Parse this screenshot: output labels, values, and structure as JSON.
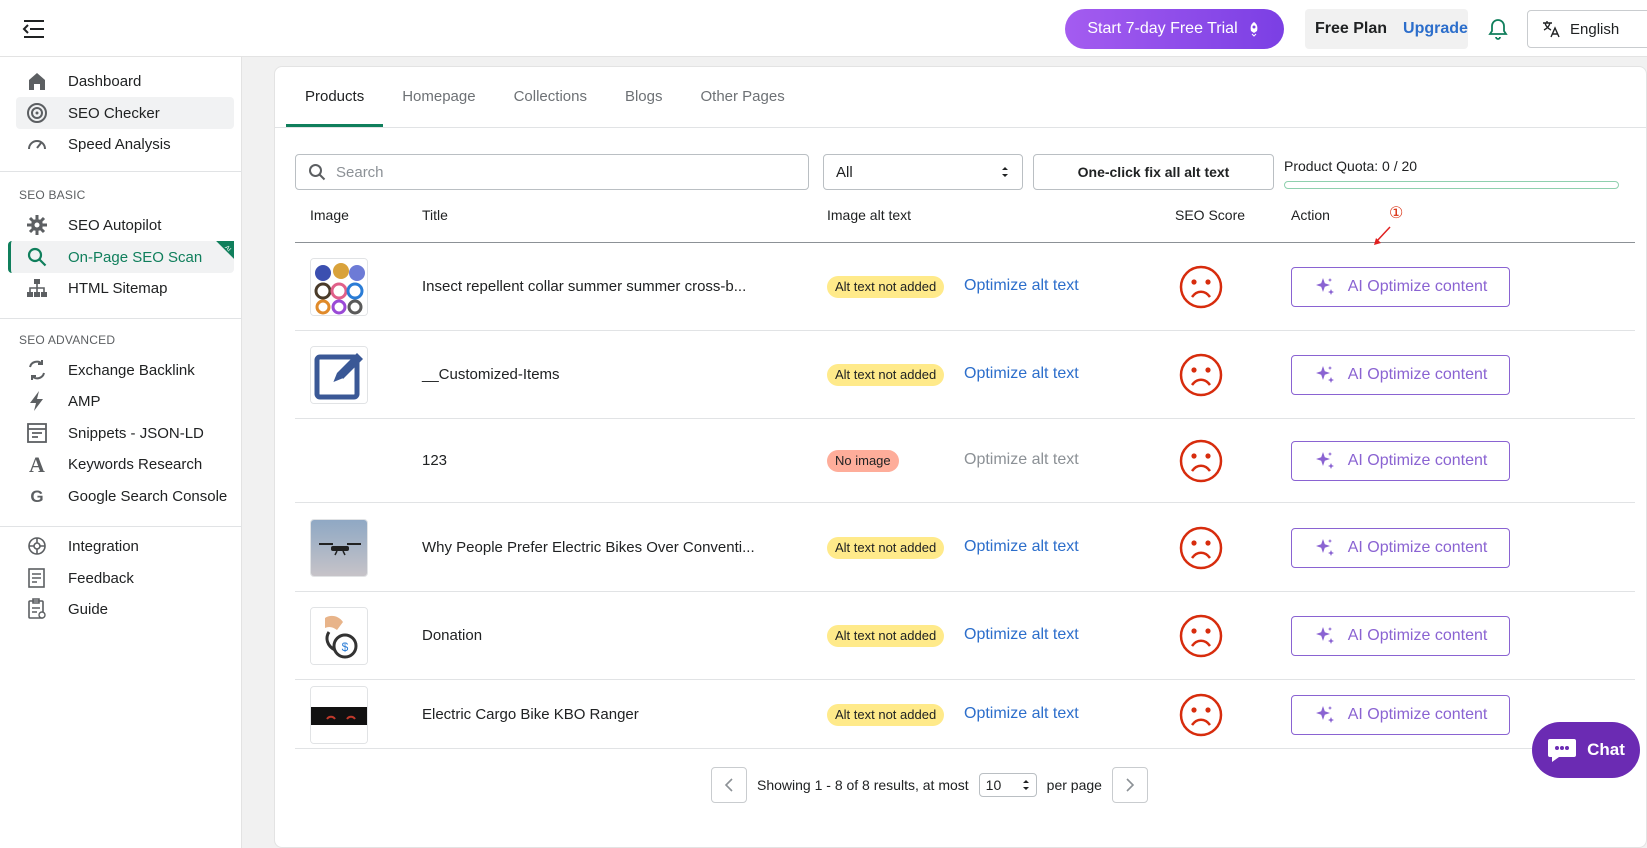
{
  "topbar": {
    "trial_label": "Start 7-day Free Trial",
    "plan_name": "Free Plan",
    "upgrade_label": "Upgrade",
    "language": "English"
  },
  "sidebar": {
    "main_items": [
      {
        "label": "Dashboard",
        "icon": "home-icon"
      },
      {
        "label": "SEO Checker",
        "icon": "target-icon"
      },
      {
        "label": "Speed Analysis",
        "icon": "speedometer-icon"
      }
    ],
    "basic_heading": "SEO BASIC",
    "basic_items": [
      {
        "label": "SEO Autopilot",
        "icon": "gear-icon"
      },
      {
        "label": "On-Page SEO Scan",
        "icon": "search-icon",
        "tag": "AI"
      },
      {
        "label": "HTML Sitemap",
        "icon": "sitemap-icon"
      }
    ],
    "advanced_heading": "SEO ADVANCED",
    "advanced_items": [
      {
        "label": "Exchange Backlink",
        "icon": "exchange-icon"
      },
      {
        "label": "AMP",
        "icon": "bolt-icon"
      },
      {
        "label": "Snippets - JSON-LD",
        "icon": "snippet-icon"
      },
      {
        "label": "Keywords Research",
        "icon": "letter-a-icon"
      },
      {
        "label": "Google Search Console",
        "icon": "google-icon"
      }
    ],
    "extra_items": [
      {
        "label": "Integration",
        "icon": "integration-icon"
      },
      {
        "label": "Feedback",
        "icon": "feedback-icon"
      },
      {
        "label": "Guide",
        "icon": "guide-icon"
      }
    ]
  },
  "tabs": [
    "Products",
    "Homepage",
    "Collections",
    "Blogs",
    "Other Pages"
  ],
  "filters": {
    "search_placeholder": "Search",
    "select_value": "All",
    "fix_all_label": "One-click fix all alt text",
    "quota_label": "Product Quota: 0 / 20",
    "quota_fraction": 0
  },
  "table": {
    "headers": {
      "image": "Image",
      "title": "Title",
      "alt": "Image alt text",
      "score": "SEO Score",
      "action": "Action"
    },
    "optimize_alt_label": "Optimize alt text",
    "ai_button_label": "AI Optimize content",
    "rows": [
      {
        "title": "Insect repellent collar summer summer cross-b...",
        "badge": "Alt text not added",
        "badge_type": "warn",
        "thumb": "collars-thumb",
        "alt_enabled": true
      },
      {
        "title": "__Customized-Items",
        "badge": "Alt text not added",
        "badge_type": "warn",
        "thumb": "edit-thumb",
        "alt_enabled": true
      },
      {
        "title": "123",
        "badge": "No image",
        "badge_type": "crit",
        "thumb": "none",
        "alt_enabled": false
      },
      {
        "title": "Why People Prefer Electric Bikes Over Conventi...",
        "badge": "Alt text not added",
        "badge_type": "warn",
        "thumb": "drone-thumb",
        "alt_enabled": true
      },
      {
        "title": "Donation",
        "badge": "Alt text not added",
        "badge_type": "warn",
        "thumb": "donation-thumb",
        "alt_enabled": true
      },
      {
        "title": "Electric Cargo Bike KBO Ranger",
        "badge": "Alt text not added",
        "badge_type": "warn",
        "thumb": "bike-thumb",
        "alt_enabled": true
      }
    ]
  },
  "annotation": "①",
  "pagination": {
    "summary": "Showing 1 - 8 of 8 results, at most",
    "per_page_value": "10",
    "per_page_label": "per page"
  },
  "chat_label": "Chat",
  "colors": {
    "brand_green": "#107f5c",
    "ai_purple": "#8a63d2",
    "link_blue": "#2c6ecb",
    "sad_face_red": "#d72c0d"
  }
}
